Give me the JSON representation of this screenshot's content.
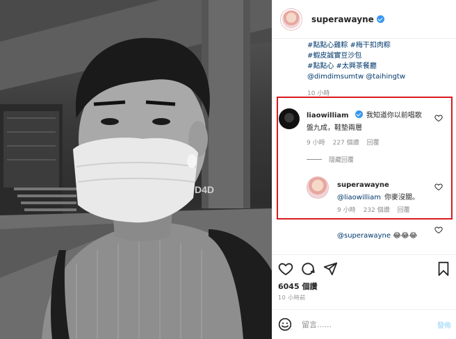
{
  "post": {
    "username": "superawayne",
    "caption_lines": [
      "#點點心雞粽 #梅干扣肉粽",
      "#蝦皮誠實豆沙包",
      "#點點心 #太興茶餐廳",
      "@dimdimsumtw @taihingtw"
    ],
    "caption_time": "10 小時",
    "likes": "6045 個讚",
    "time_ago": "10 小時前",
    "photo_sign": "D4D"
  },
  "comments": [
    {
      "username": "liaowilliam",
      "text_line1": "我知道你以前唱歌",
      "text_line2": "盤九成，鞋墊兩層",
      "time": "9 小時",
      "likes": "227 個讚",
      "reply_label": "回覆"
    }
  ],
  "hide_replies_label": "隱藏回覆",
  "reply": {
    "username": "superawayne",
    "mention": "@liaowilliam",
    "text": "你麥沒關。",
    "time": "9 小時",
    "likes": "232 個讚",
    "reply_label": "回覆"
  },
  "partial_comment": {
    "mention": "@superawayne",
    "emojis": "😂😂😂"
  },
  "comment_box": {
    "placeholder": "留言......",
    "post_label": "發佈"
  },
  "colors": {
    "highlight": "#d9191f",
    "verified": "#3897f0",
    "link": "#00376b"
  }
}
